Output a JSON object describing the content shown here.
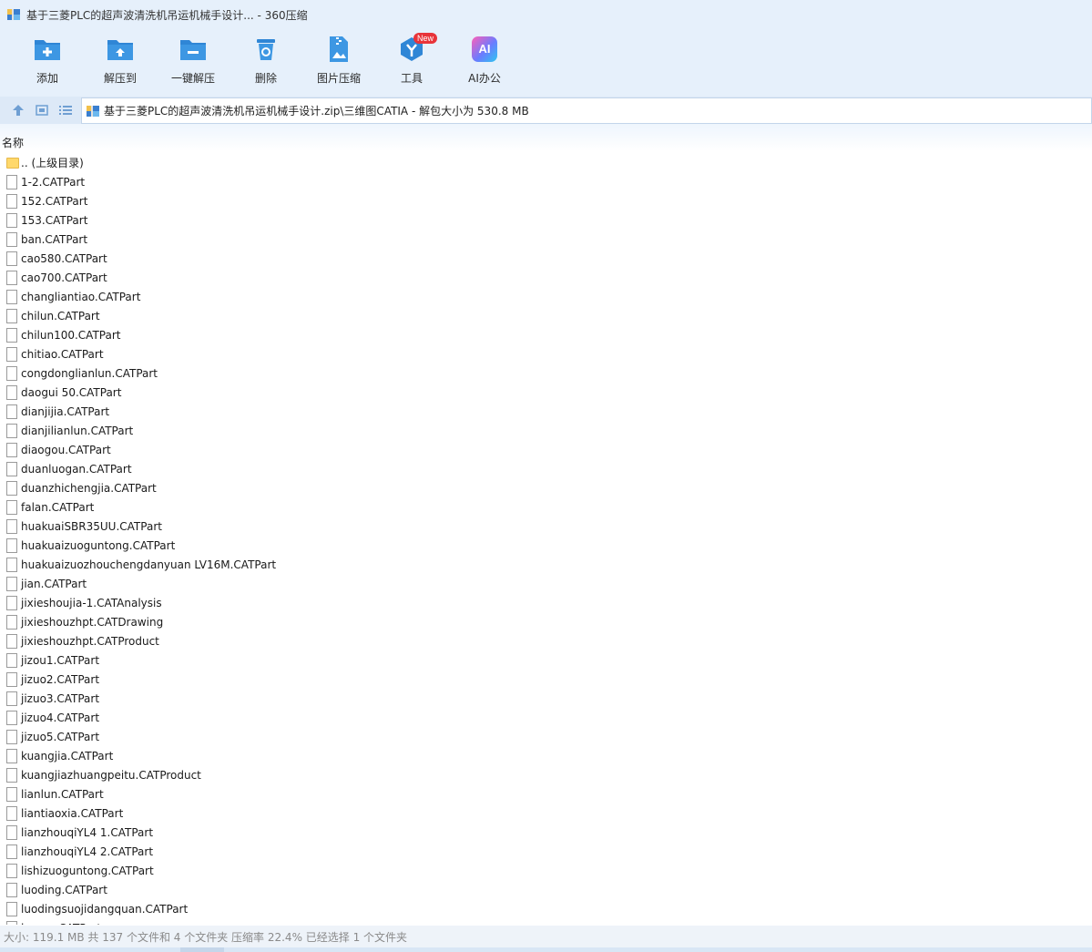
{
  "window": {
    "title": "基于三菱PLC的超声波清洗机吊运机械手设计... - 360压缩"
  },
  "toolbar": {
    "add_label": "添加",
    "extract_to_label": "解压到",
    "one_click_extract_label": "一键解压",
    "delete_label": "删除",
    "image_compress_label": "图片压缩",
    "tools_label": "工具",
    "tools_badge": "New",
    "ai_office_label": "AI办公",
    "ai_icon_text": "AI"
  },
  "nav": {
    "path": "基于三菱PLC的超声波清洗机吊运机械手设计.zip\\三维图CATIA - 解包大小为 530.8 MB"
  },
  "list": {
    "column_name": "名称",
    "parent_label": ".. (上级目录)",
    "files": [
      "1-2.CATPart",
      "152.CATPart",
      "153.CATPart",
      "ban.CATPart",
      "cao580.CATPart",
      "cao700.CATPart",
      "changliantiao.CATPart",
      "chilun.CATPart",
      "chilun100.CATPart",
      "chitiao.CATPart",
      "congdonglianlun.CATPart",
      "daogui 50.CATPart",
      "dianjijia.CATPart",
      "dianjilianlun.CATPart",
      "diaogou.CATPart",
      "duanluogan.CATPart",
      "duanzhichengjia.CATPart",
      "falan.CATPart",
      "huakuaiSBR35UU.CATPart",
      "huakuaizuoguntong.CATPart",
      "huakuaizuozhouchengdanyuan LV16M.CATPart",
      "jian.CATPart",
      "jixieshoujia-1.CATAnalysis",
      "jixieshouzhpt.CATDrawing",
      "jixieshouzhpt.CATProduct",
      "jizou1.CATPart",
      "jizuo2.CATPart",
      "jizuo3.CATPart",
      "jizuo4.CATPart",
      "jizuo5.CATPart",
      "kuangjia.CATPart",
      "kuangjiazhuangpeitu.CATProduct",
      "lianlun.CATPart",
      "liantiaoxia.CATPart",
      "lianzhouqiYL4 1.CATPart",
      "lianzhouqiYL4 2.CATPart",
      "lishizuoguntong.CATPart",
      "luoding.CATPart",
      "luodingsuojidangquan.CATPart",
      "luomu.CATPart"
    ]
  },
  "status": {
    "text": "大小: 119.1 MB 共 137 个文件和 4 个文件夹 压缩率 22.4% 已经选择 1 个文件夹"
  },
  "colors": {
    "chrome_bg": "#e6f0fb",
    "accent_blue": "#2f86d6",
    "badge_red": "#e8343a",
    "folder_yellow": "#ffd86b"
  }
}
